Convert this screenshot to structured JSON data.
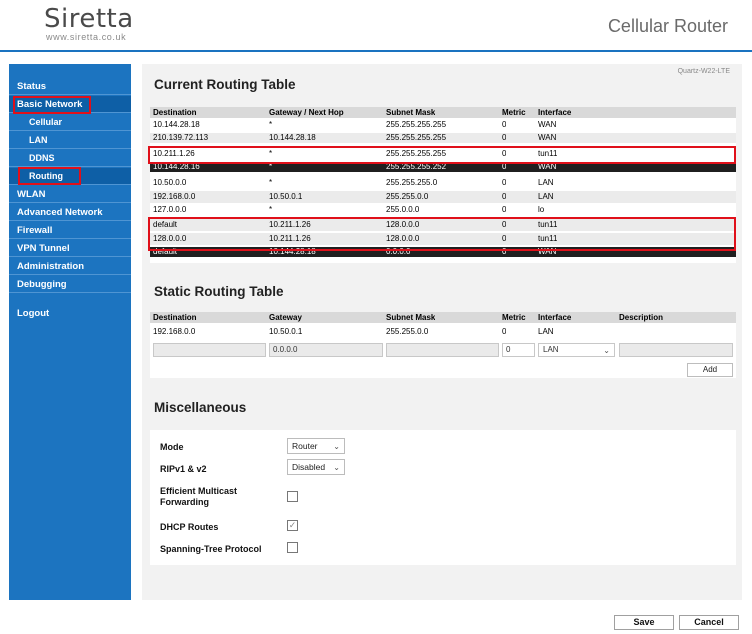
{
  "header": {
    "logo_name": "Siretta",
    "logo_url": "www.siretta.co.uk",
    "product_title": "Cellular Router"
  },
  "sidebar": {
    "items": [
      {
        "label": "Status"
      },
      {
        "label": "Basic Network"
      },
      {
        "label": "Cellular"
      },
      {
        "label": "LAN"
      },
      {
        "label": "DDNS"
      },
      {
        "label": "Routing"
      },
      {
        "label": "WLAN"
      },
      {
        "label": "Advanced Network"
      },
      {
        "label": "Firewall"
      },
      {
        "label": "VPN Tunnel"
      },
      {
        "label": "Administration"
      },
      {
        "label": "Debugging"
      },
      {
        "label": "Logout"
      }
    ]
  },
  "main": {
    "model": "Quartz-W22-LTE",
    "current_routing": {
      "title": "Current Routing Table",
      "headers": [
        "Destination",
        "Gateway / Next Hop",
        "Subnet Mask",
        "Metric",
        "Interface"
      ],
      "rows": [
        [
          "10.144.28.18",
          "*",
          "255.255.255.255",
          "0",
          "WAN"
        ],
        [
          "210.139.72.113",
          "10.144.28.18",
          "255.255.255.255",
          "0",
          "WAN"
        ],
        [
          "10.211.1.26",
          "*",
          "255.255.255.255",
          "0",
          "tun11"
        ],
        [
          "10.144.28.16",
          "*",
          "255.255.255.252",
          "0",
          "WAN"
        ],
        [
          "10.50.0.0",
          "*",
          "255.255.255.0",
          "0",
          "LAN"
        ],
        [
          "192.168.0.0",
          "10.50.0.1",
          "255.255.0.0",
          "0",
          "LAN"
        ],
        [
          "127.0.0.0",
          "*",
          "255.0.0.0",
          "0",
          "lo"
        ],
        [
          "default",
          "10.211.1.26",
          "128.0.0.0",
          "0",
          "tun11"
        ],
        [
          "128.0.0.0",
          "10.211.1.26",
          "128.0.0.0",
          "0",
          "tun11"
        ],
        [
          "default",
          "10.144.28.18",
          "0.0.0.0",
          "0",
          "WAN"
        ]
      ]
    },
    "static_routing": {
      "title": "Static Routing Table",
      "headers": [
        "Destination",
        "Gateway",
        "Subnet Mask",
        "Metric",
        "Interface",
        "Description"
      ],
      "rows": [
        [
          "192.168.0.0",
          "10.50.0.1",
          "255.255.0.0",
          "0",
          "LAN",
          ""
        ]
      ],
      "new_row": {
        "destination": "",
        "gateway": "0.0.0.0",
        "subnet_mask": "",
        "metric": "0",
        "interface": "LAN",
        "description": ""
      },
      "add_label": "Add"
    },
    "misc": {
      "title": "Miscellaneous",
      "mode_label": "Mode",
      "mode_value": "Router",
      "rip_label": "RIPv1 & v2",
      "rip_value": "Disabled",
      "multicast_label_1": "Efficient Multicast",
      "multicast_label_2": "Forwarding",
      "multicast_checked": false,
      "dhcp_label": "DHCP Routes",
      "dhcp_checked": true,
      "stp_label": "Spanning-Tree Protocol",
      "stp_checked": false
    }
  },
  "footer": {
    "save_label": "Save",
    "cancel_label": "Cancel"
  },
  "colors": {
    "brand_blue": "#1c74c0",
    "highlight_red": "#e0101a"
  }
}
